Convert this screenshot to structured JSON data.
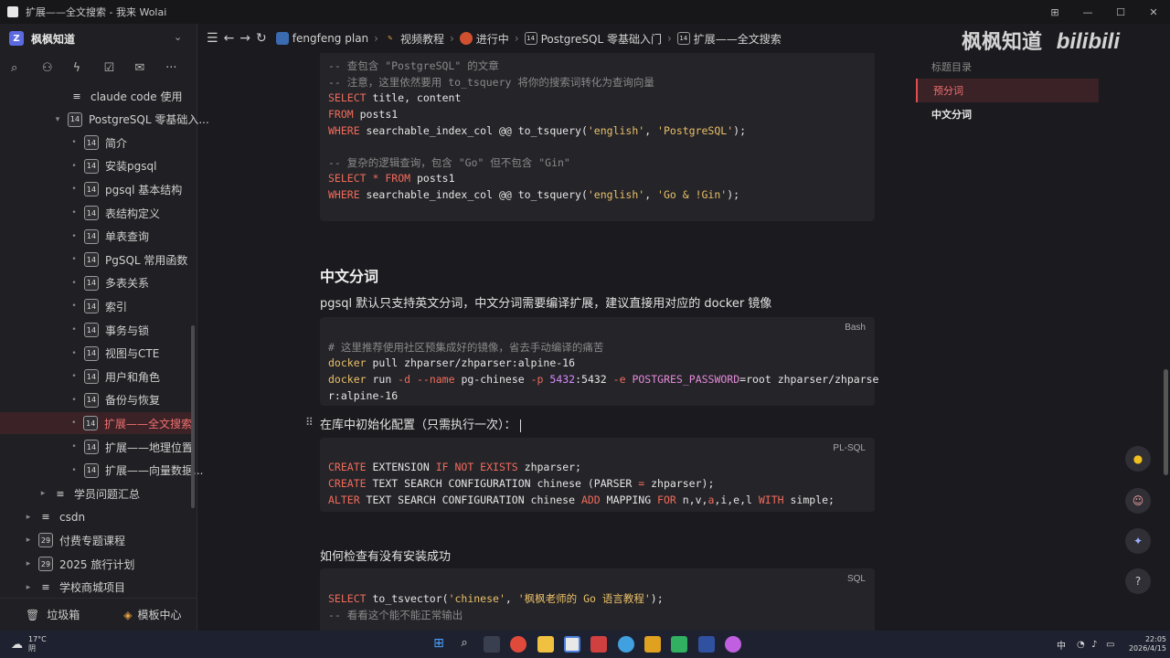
{
  "window": {
    "title": "扩展——全文搜索 - 我来 Wolai"
  },
  "sidebar": {
    "workspace": "枫枫知道",
    "items": [
      {
        "label": "claude code 使用",
        "kind": "doc",
        "arrow": ""
      },
      {
        "label": "PostgreSQL 零基础入...",
        "kind": "page",
        "arrow": "▾"
      },
      {
        "label": "简介",
        "kind": "page",
        "arrow": "•"
      },
      {
        "label": "安装pgsql",
        "kind": "page",
        "arrow": "•"
      },
      {
        "label": "pgsql 基本结构",
        "kind": "page",
        "arrow": "•"
      },
      {
        "label": "表结构定义",
        "kind": "page",
        "arrow": "•"
      },
      {
        "label": "单表查询",
        "kind": "page",
        "arrow": "•"
      },
      {
        "label": "PgSQL 常用函数",
        "kind": "page",
        "arrow": "•"
      },
      {
        "label": "多表关系",
        "kind": "page",
        "arrow": "•"
      },
      {
        "label": "索引",
        "kind": "page",
        "arrow": "•"
      },
      {
        "label": "事务与锁",
        "kind": "page",
        "arrow": "•"
      },
      {
        "label": "视图与CTE",
        "kind": "page",
        "arrow": "•"
      },
      {
        "label": "用户和角色",
        "kind": "page",
        "arrow": "•"
      },
      {
        "label": "备份与恢复",
        "kind": "page",
        "arrow": "•"
      },
      {
        "label": "扩展——全文搜索",
        "kind": "page",
        "arrow": "•"
      },
      {
        "label": "扩展——地理位置",
        "kind": "page",
        "arrow": "•"
      },
      {
        "label": "扩展——向量数据...",
        "kind": "page",
        "arrow": "•"
      },
      {
        "label": "学员问题汇总",
        "kind": "doc",
        "arrow": "▸"
      },
      {
        "label": "csdn",
        "kind": "doc",
        "arrow": "▸"
      },
      {
        "label": "付费专题课程",
        "kind": "page29",
        "arrow": "▸"
      },
      {
        "label": "2025 旅行计划",
        "kind": "page29",
        "arrow": "▸"
      },
      {
        "label": "学校商城项目",
        "kind": "doc",
        "arrow": "▸"
      }
    ],
    "trash": "垃圾箱",
    "templates": "模板中心"
  },
  "breadcrumb": [
    "fengfeng plan",
    "视频教程",
    "进行中",
    "PostgreSQL 零基础入门",
    "扩展——全文搜索"
  ],
  "watermark": "枫枫知道",
  "watermark_brand": "bilibili",
  "page_icon_num": "14",
  "page_icon_num2": "29",
  "outline": {
    "title": "标题目录",
    "items": [
      "预分词",
      "中文分词"
    ]
  },
  "content": {
    "heading": "中文分词",
    "intro": "pgsql 默认只支持英文分词，中文分词需要编译扩展，建议直接用对应的 docker 镜像",
    "init_text": "在库中初始化配置（只需执行一次）：",
    "check_text": "如何检查有没有安装成功",
    "lang1": "Bash",
    "lang2": "PL-SQL",
    "lang3": "SQL"
  },
  "system": {
    "temp": "17°C",
    "weather": "阴",
    "time": "22:05",
    "date": "2026/4/15",
    "ime": "中"
  }
}
